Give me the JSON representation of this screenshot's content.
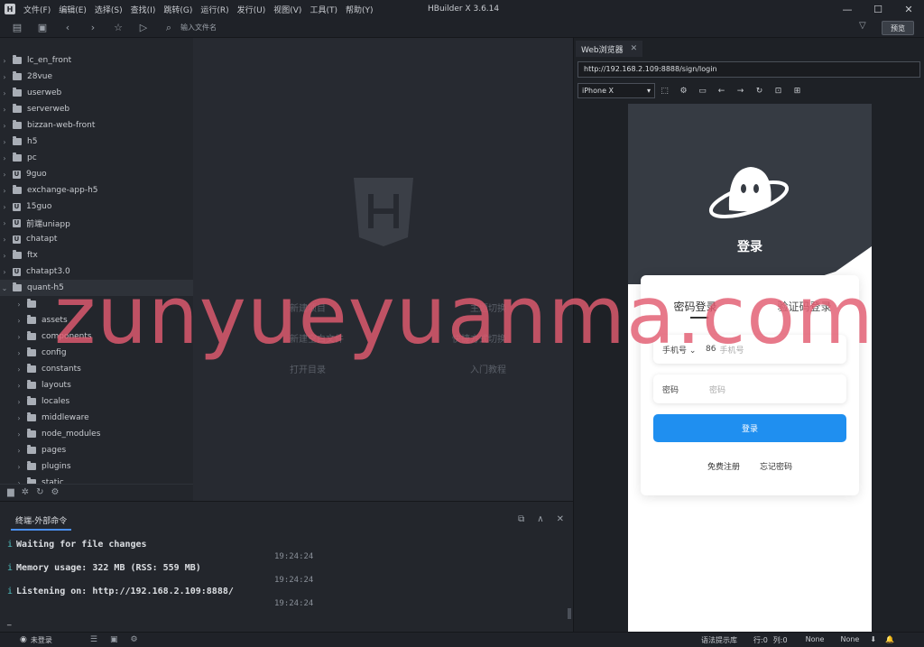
{
  "titlebar": {
    "app_title": "HBuilder X 3.6.14",
    "menu": [
      "文件(F)",
      "编辑(E)",
      "选择(S)",
      "查找(I)",
      "跳转(G)",
      "运行(R)",
      "发行(U)",
      "视图(V)",
      "工具(T)",
      "帮助(Y)"
    ]
  },
  "toolbar": {
    "input_placeholder": "输入文件名",
    "preview_label": "预览"
  },
  "tree": {
    "items": [
      {
        "label": "lc_en_front",
        "type": "folder"
      },
      {
        "label": "28vue",
        "type": "folder"
      },
      {
        "label": "userweb",
        "type": "folder"
      },
      {
        "label": "serverweb",
        "type": "folder"
      },
      {
        "label": "bizzan-web-front",
        "type": "folder"
      },
      {
        "label": "h5",
        "type": "folder"
      },
      {
        "label": "pc",
        "type": "folder"
      },
      {
        "label": "9guo",
        "type": "uni"
      },
      {
        "label": "exchange-app-h5",
        "type": "folder"
      },
      {
        "label": "15guo",
        "type": "uni"
      },
      {
        "label": "前端uniapp",
        "type": "uni"
      },
      {
        "label": "chatapt",
        "type": "uni"
      },
      {
        "label": "ftx",
        "type": "folder"
      },
      {
        "label": "chatapt3.0",
        "type": "uni"
      },
      {
        "label": "quant-h5",
        "type": "folder"
      }
    ],
    "children": [
      "",
      "assets",
      "components",
      "config",
      "constants",
      "layouts",
      "locales",
      "middleware",
      "node_modules",
      "pages",
      "plugins",
      "static"
    ]
  },
  "editor": {
    "links": [
      [
        "新建项目",
        "主题切换"
      ],
      [
        "新建空白文件",
        "快捷方式切换"
      ],
      [
        "打开目录",
        "入门教程"
      ]
    ]
  },
  "terminal": {
    "tab_label": "终端-外部命令",
    "lines": [
      {
        "prefix": "i",
        "text": "Waiting for file changes",
        "time": "19:24:24"
      },
      {
        "prefix": "i",
        "label": "Memory usage:",
        "text": "322 MB (RSS: 559 MB)",
        "time": "19:24:24"
      },
      {
        "prefix": "i",
        "label": "Listening on:",
        "text": "http://192.168.2.109:8888/",
        "time": "19:24:24"
      }
    ],
    "cursor": "_"
  },
  "browser": {
    "tab_label": "Web浏览器",
    "url": "http://192.168.2.109:8888/sign/login",
    "device": "iPhone X",
    "page": {
      "title": "登录",
      "tab_password": "密码登录",
      "tab_code": "验证码登录",
      "phone_label": "手机号",
      "phone_prefix": "86",
      "phone_placeholder": "手机号",
      "password_label": "密码",
      "password_placeholder": "密码",
      "login_button": "登录",
      "register_link": "免费注册",
      "forgot_link": "忘记密码"
    }
  },
  "watermark": "zunyueyuanma.com",
  "statusbar": {
    "login_status": "未登录",
    "syntax_hint": "语法提示库",
    "line": "行:0",
    "col": "列:0",
    "encoding1": "None",
    "encoding2": "None"
  }
}
